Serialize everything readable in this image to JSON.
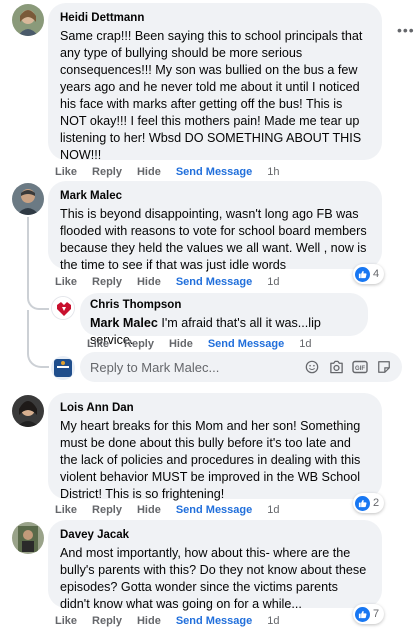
{
  "comments": [
    {
      "author": "Heidi Dettmann",
      "text": "Same crap!!! Been saying this to school principals that any type of bullying should be more serious consequences!!! My son was bullied on the bus a few years ago and he never told me about it until I noticed his face with marks after getting off the bus! This is NOT okay!!! I feel this mothers pain! Made me tear up listening to her! Wbsd DO SOMETHING ABOUT THIS NOW!!!",
      "like_label": "Like",
      "reply_label": "Reply",
      "hide_label": "Hide",
      "send_label": "Send Message",
      "time": "1h"
    },
    {
      "author": "Mark Malec",
      "text": "This is beyond disappointing, wasn't long ago FB was flooded with reasons to vote for school board members because they held the values we all want. Well , now is the time to see if that was just idle words",
      "like_label": "Like",
      "reply_label": "Reply",
      "hide_label": "Hide",
      "send_label": "Send Message",
      "time": "1d",
      "reactions": "4"
    },
    {
      "author": "Lois Ann Dan",
      "text": "My heart breaks for this Mom and her son! Something must be done about this bully before it's too late and the lack of policies and procedures in dealing with this violent behavior MUST be improved in the WB School District! This is so frightening!",
      "like_label": "Like",
      "reply_label": "Reply",
      "hide_label": "Hide",
      "send_label": "Send Message",
      "time": "1d",
      "reactions": "2"
    },
    {
      "author": "Davey Jacak",
      "text": "And most importantly, how about this- where are the bully's parents with this? Do they not know about these episodes? Gotta wonder since the victims parents didn't know what was going on for a while...",
      "like_label": "Like",
      "reply_label": "Reply",
      "hide_label": "Hide",
      "send_label": "Send Message",
      "time": "1d",
      "reactions": "7"
    }
  ],
  "reply": {
    "author": "Chris Thompson",
    "mention": "Mark Malec",
    "text": " I'm afraid that's all it was...lip service.",
    "like_label": "Like",
    "reply_label": "Reply",
    "hide_label": "Hide",
    "send_label": "Send Message",
    "time": "1d"
  },
  "reply_box": {
    "placeholder": "Reply to Mark Malec..."
  },
  "icons": [
    "more-options-icon",
    "like-icon",
    "emoji-icon",
    "camera-icon",
    "gif-icon",
    "sticker-icon"
  ],
  "colors": {
    "bubble": "#f0f2f5",
    "link": "#216fdb",
    "meta": "#65676b",
    "like_blue": "#1877f2"
  }
}
